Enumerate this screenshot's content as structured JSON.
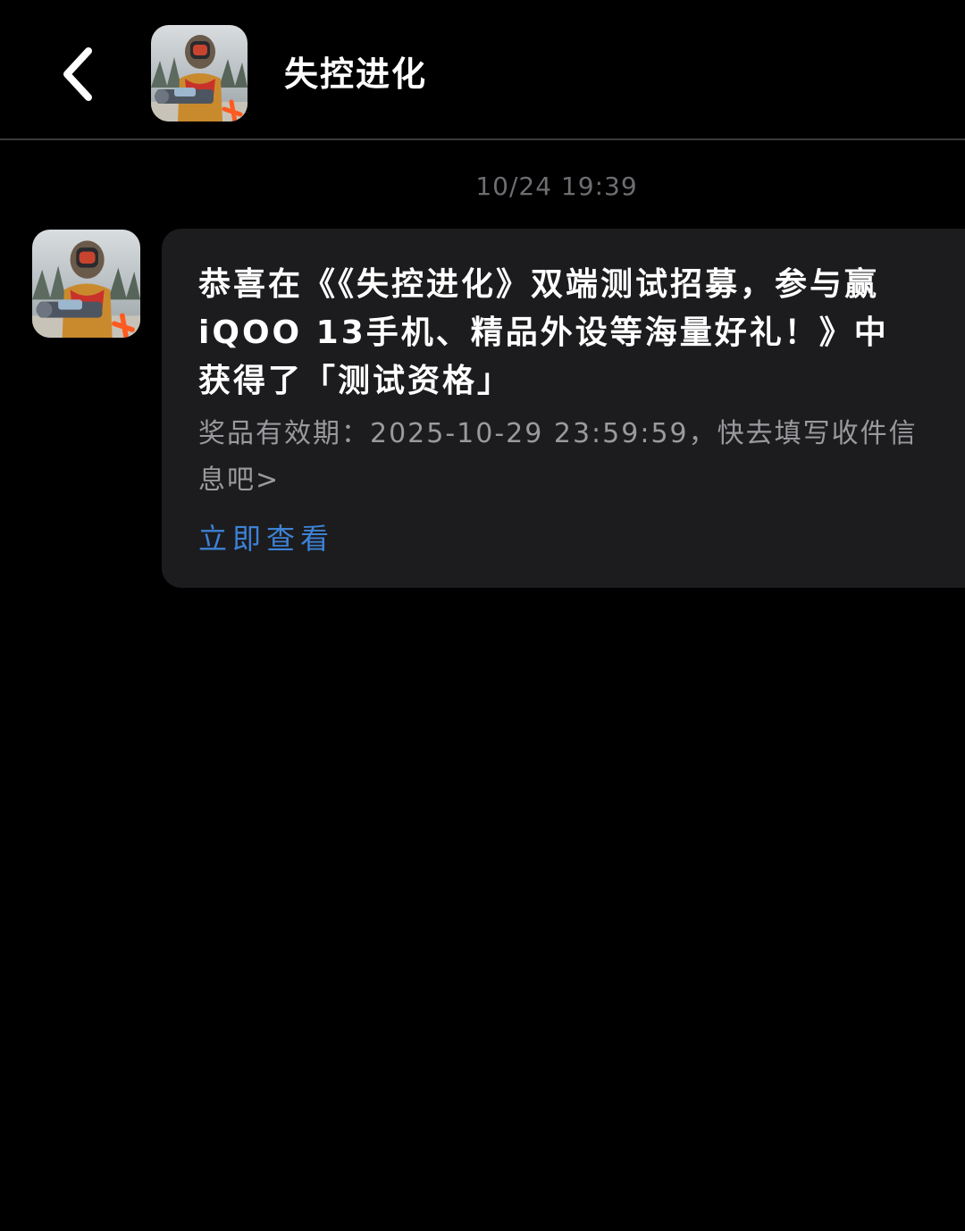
{
  "header": {
    "back_icon": "chevron-left-icon",
    "title": "失控进化"
  },
  "conversation": {
    "timestamp": "10/24 19:39",
    "message": {
      "title": "恭喜在《《失控进化》双端测试招募，参与赢iQOO 13手机、精品外设等海量好礼！》中获得了「测试资格」",
      "body": "奖品有效期：2025-10-29 23:59:59，快去填写收件信息吧>",
      "link_label": "立即查看"
    }
  },
  "colors": {
    "background": "#000000",
    "bubble": "#1c1c1e",
    "divider": "#3a3a3c",
    "timestamp": "#6d6d72",
    "body_text": "#9a9a9e",
    "link": "#3d82d6"
  }
}
